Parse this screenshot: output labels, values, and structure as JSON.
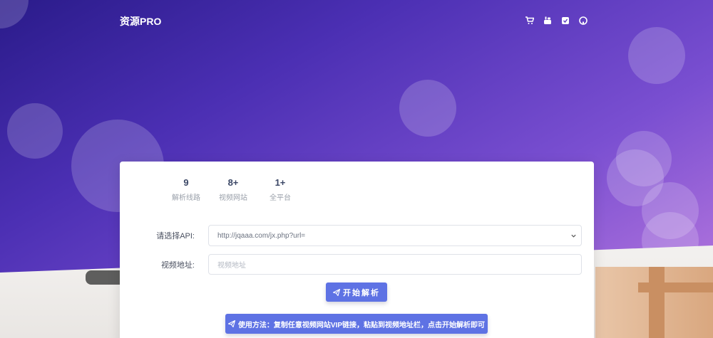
{
  "brand": "资源PRO",
  "nav_icons": [
    "cart-icon",
    "youtube-icon",
    "check-square-icon",
    "github-icon"
  ],
  "stats": [
    {
      "value": "9",
      "label": "解析线路"
    },
    {
      "value": "8+",
      "label": "视频网站"
    },
    {
      "value": "1+",
      "label": "全平台"
    }
  ],
  "form": {
    "api_label": "请选择API:",
    "api_selected": "http://jqaaa.com/jx.php?url=",
    "url_label": "视频地址:",
    "url_placeholder": "视频地址",
    "start_button": "开始解析",
    "usage_button": "使用方法：复制任意视频网站VIP链接，粘贴到视频地址栏，点击开始解析即可"
  },
  "colors": {
    "accent": "#5e72e4",
    "gradient_start": "#2a1b8a",
    "gradient_end": "#c07ee0"
  }
}
